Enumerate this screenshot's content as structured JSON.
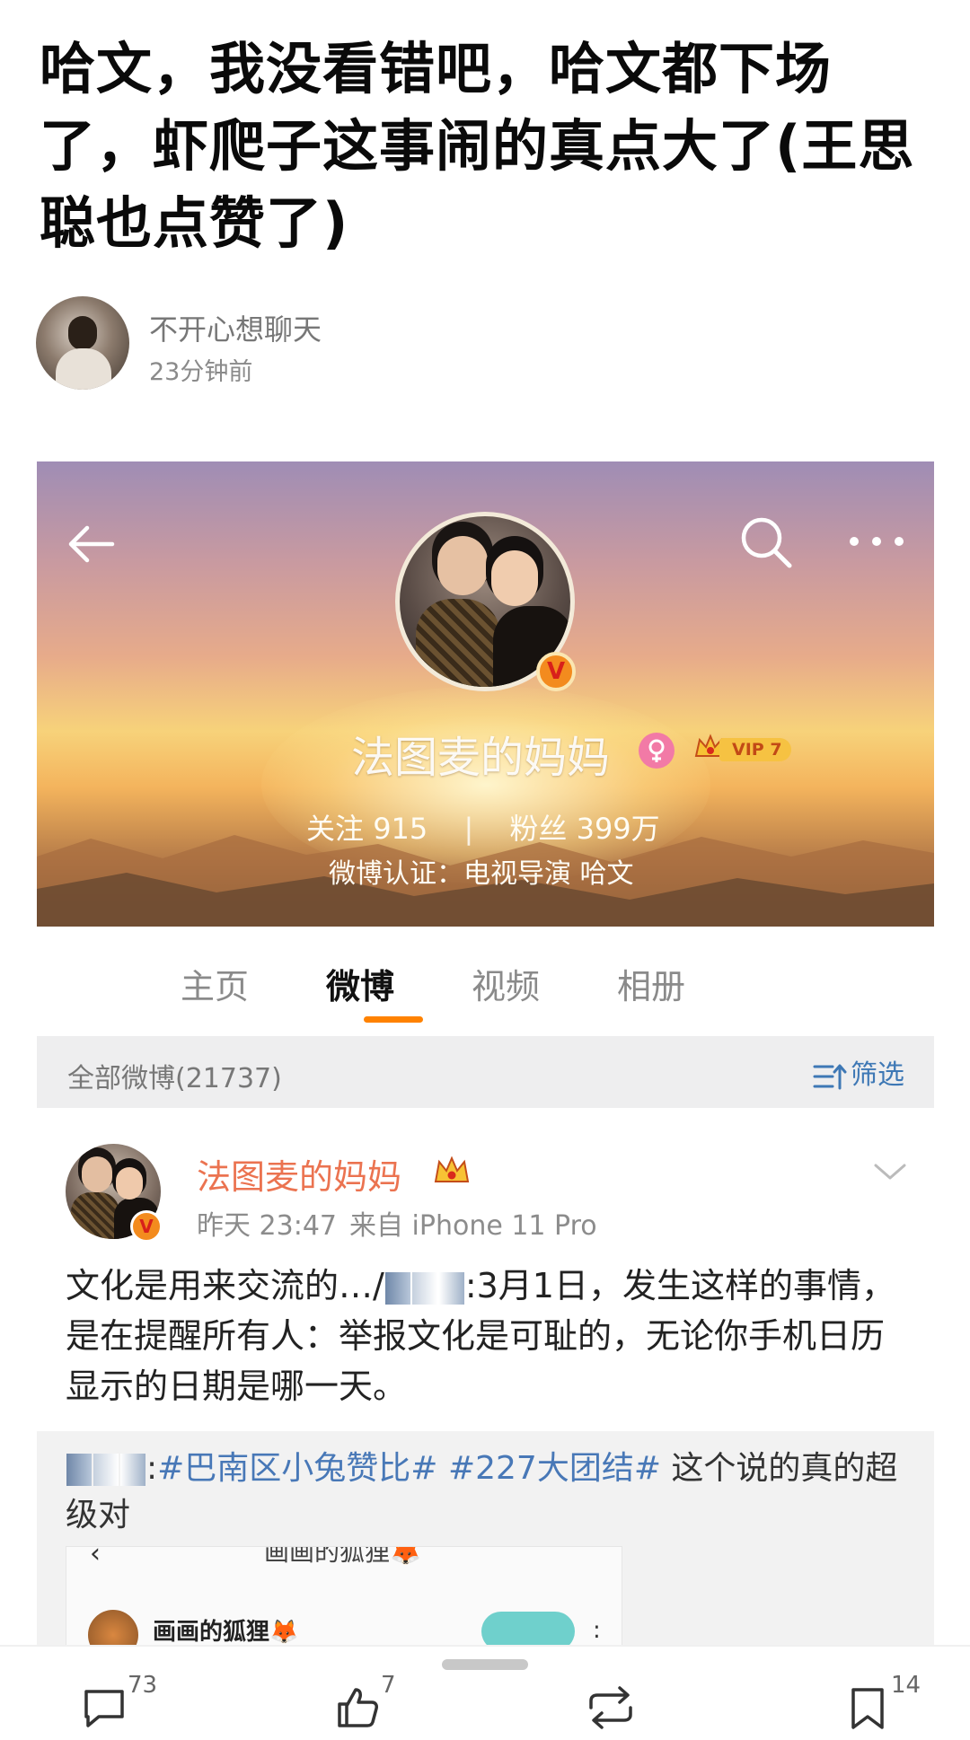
{
  "article": {
    "title": "哈文，我没看错吧，哈文都下场了，虾爬子这事闹的真点大了(王思聪也点赞了)",
    "author_name": "不开心想聊天",
    "time": "23分钟前"
  },
  "profile": {
    "name": "法图麦的妈妈",
    "vip": "VIP 7",
    "following_label": "关注",
    "following_count": "915",
    "fans_label": "粉丝",
    "fans_count": "399万",
    "verify_text": "微博认证：电视导演 哈文",
    "verified_mark": "V"
  },
  "tabs": [
    {
      "label": "主页"
    },
    {
      "label": "微博",
      "active": true
    },
    {
      "label": "视频"
    },
    {
      "label": "相册"
    }
  ],
  "feed": {
    "count_label": "全部微博(21737)",
    "filter_label": "筛选"
  },
  "post": {
    "author": "法图麦的妈妈",
    "time": "昨天 23:47",
    "source": "来自 iPhone 11 Pro",
    "text_prefix": "文化是用来交流的…/",
    "text_body": ":3月1日，发生这样的事情，是在提醒所有人：举报文化是可耻的，无论你手机日历显示的日期是哪一天。",
    "verified_mark": "V"
  },
  "repost": {
    "text_prefix": ":",
    "tag1": "#巴南区小兔赞比#",
    "tag2": "#227大团结#",
    "text_suffix": " 这个说的真的超级对",
    "image_top_text": "画画的狐狸🦊",
    "image_name": "画画的狐狸🦊"
  },
  "actions": {
    "comments": "73",
    "likes": "7",
    "reposts": "",
    "favorites": "14"
  },
  "colors": {
    "accent": "#ff8200",
    "author_orange": "#eb7350",
    "link_blue": "#4878b7"
  }
}
